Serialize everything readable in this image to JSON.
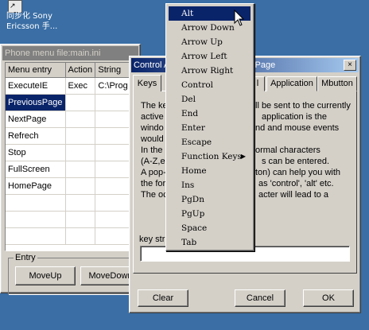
{
  "desktop": {
    "icon_label_line1": "同步化 Sony",
    "icon_label_line2": "Ericsson 手..."
  },
  "phone_window": {
    "title": "Phone menu file:main.ini",
    "columns": [
      "Menu entry",
      "Action",
      "String"
    ],
    "rows": [
      [
        "ExecuteIE",
        "Exec",
        "C:\\Prog"
      ],
      [
        "PreviousPage",
        "",
        ""
      ],
      [
        "NextPage",
        "",
        ""
      ],
      [
        "Refrech",
        "",
        ""
      ],
      [
        "Stop",
        "",
        ""
      ],
      [
        "FullScreen",
        "",
        ""
      ],
      [
        "HomePage",
        "",
        ""
      ],
      [
        "",
        "",
        ""
      ],
      [
        "",
        "",
        ""
      ],
      [
        "",
        "",
        ""
      ]
    ],
    "entry_group_label": "Entry",
    "moveup_label": "MoveUp",
    "movedown_label": "MoveDown"
  },
  "control_window": {
    "title": "Control A",
    "title_right": "sPage",
    "close_glyph": "×",
    "tabs": {
      "keys": "Keys",
      "hidden": "l",
      "application": "Application",
      "mbutton": "Mbutton"
    },
    "body": [
      {
        "left": "The ke",
        "right": "ll be sent to the currently"
      },
      {
        "left": "active",
        "right": "application is the"
      },
      {
        "left": "windo",
        "right": "nd and mouse events"
      },
      {
        "left": "would",
        "right": ""
      },
      {
        "left": "In the '",
        "right": "ormal characters"
      },
      {
        "left": "(A-Z,e",
        "right": "s can be entered."
      },
      {
        "left": "A pop-",
        "right": "ton) can help you with"
      },
      {
        "left": "the for",
        "right": "as 'control', 'alt' etc."
      },
      {
        "left": "The oc",
        "right": "acter will lead to a"
      }
    ],
    "key_label": "key str",
    "key_value": "",
    "clear_label": "Clear",
    "cancel_label": "Cancel",
    "ok_label": "OK"
  },
  "key_menu": {
    "items": [
      {
        "label": "Alt",
        "highlighted": true
      },
      {
        "label": "Arrow Down"
      },
      {
        "label": "Arrow Up"
      },
      {
        "label": "Arrow Left"
      },
      {
        "label": "Arrow Right"
      },
      {
        "label": "Control"
      },
      {
        "label": "Del"
      },
      {
        "label": "End"
      },
      {
        "label": "Enter"
      },
      {
        "label": "Escape"
      },
      {
        "label": "Function Keys",
        "submenu": true
      },
      {
        "label": "Home"
      },
      {
        "label": "Ins"
      },
      {
        "label": "PgDn"
      },
      {
        "label": "PgUp"
      },
      {
        "label": "Space"
      },
      {
        "label": "Tab"
      }
    ]
  },
  "colors": {
    "desktop": "#3a6ea5",
    "face": "#d4d0c8",
    "selection": "#0a246a"
  }
}
